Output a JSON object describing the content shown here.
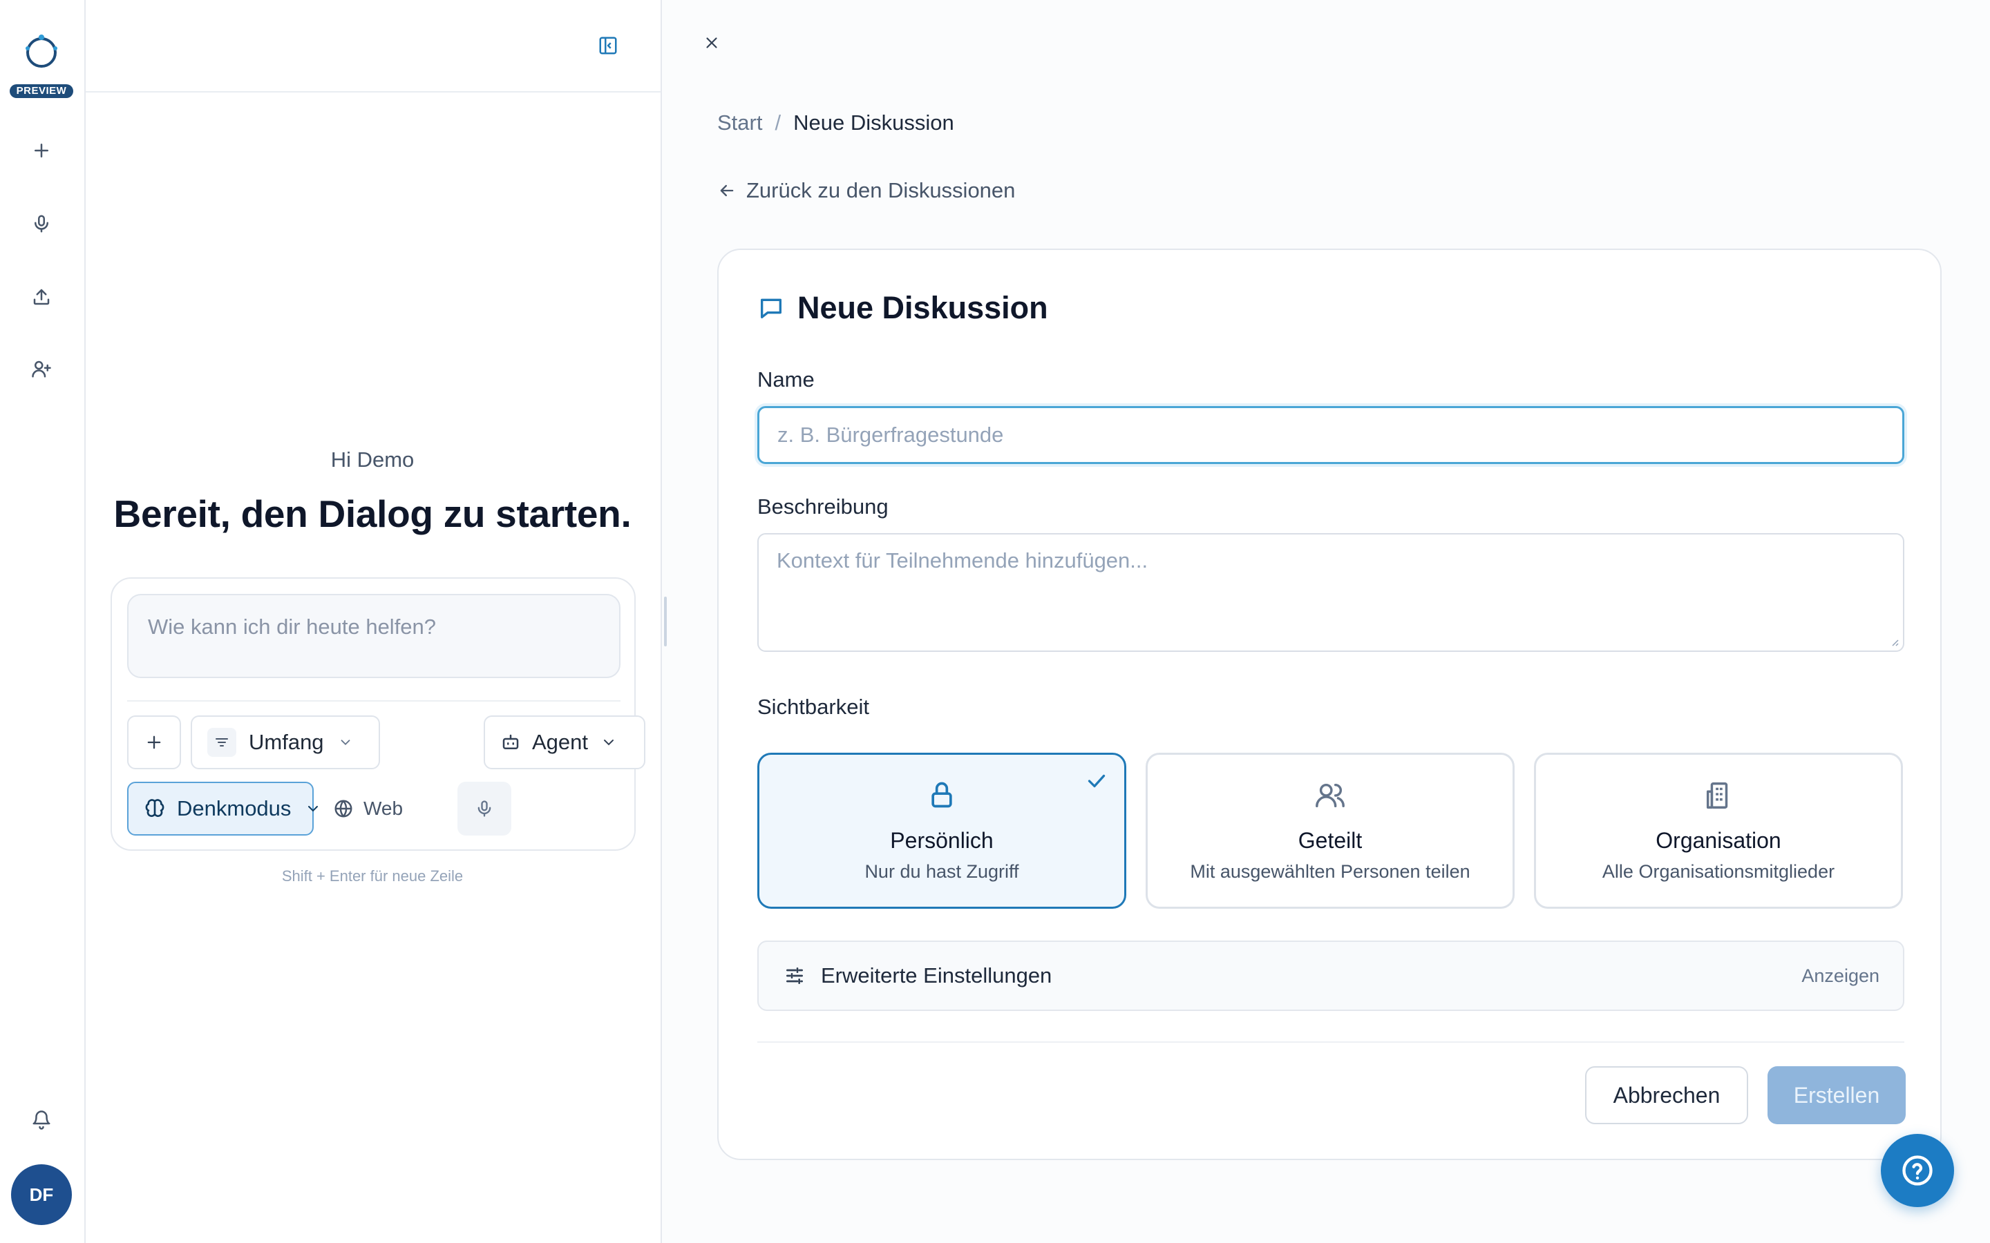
{
  "app": {
    "preview_badge": "PREVIEW",
    "avatar_initials": "DF"
  },
  "rail_icons": [
    "plus-icon",
    "mic-icon",
    "upload-icon",
    "user-plus-icon",
    "bell-icon"
  ],
  "chat": {
    "greeting": "Hi Demo",
    "headline": "Bereit, den Dialog zu starten.",
    "input_placeholder": "Wie kann ich dir heute helfen?",
    "scope_label": "Umfang",
    "agent_label": "Agent",
    "thinking_label": "Denkmodus",
    "web_label": "Web",
    "hint": "Shift + Enter für neue Zeile"
  },
  "breadcrumb": {
    "root": "Start",
    "separator": "/",
    "current": "Neue Diskussion"
  },
  "back_link": "Zurück zu den Diskussionen",
  "form": {
    "title": "Neue Diskussion",
    "name_label": "Name",
    "name_placeholder": "z. B. Bürgerfragestunde",
    "description_label": "Beschreibung",
    "description_placeholder": "Kontext für Teilnehmende hinzufügen...",
    "visibility_label": "Sichtbarkeit",
    "visibility_options": [
      {
        "title": "Persönlich",
        "subtitle": "Nur du hast Zugriff",
        "icon": "lock-icon",
        "selected": true
      },
      {
        "title": "Geteilt",
        "subtitle": "Mit ausgewählten Personen teilen",
        "icon": "users-icon",
        "selected": false
      },
      {
        "title": "Organisation",
        "subtitle": "Alle Organisationsmitglieder",
        "icon": "building-icon",
        "selected": false
      }
    ],
    "advanced_label": "Erweiterte Einstellungen",
    "advanced_toggle": "Anzeigen",
    "cancel_label": "Abbrechen",
    "create_label": "Erstellen"
  },
  "colors": {
    "accent": "#1f79b7",
    "primary_disabled": "#8fb5dc",
    "avatar": "#1e4f8f",
    "help_button": "#1c7cc4"
  }
}
